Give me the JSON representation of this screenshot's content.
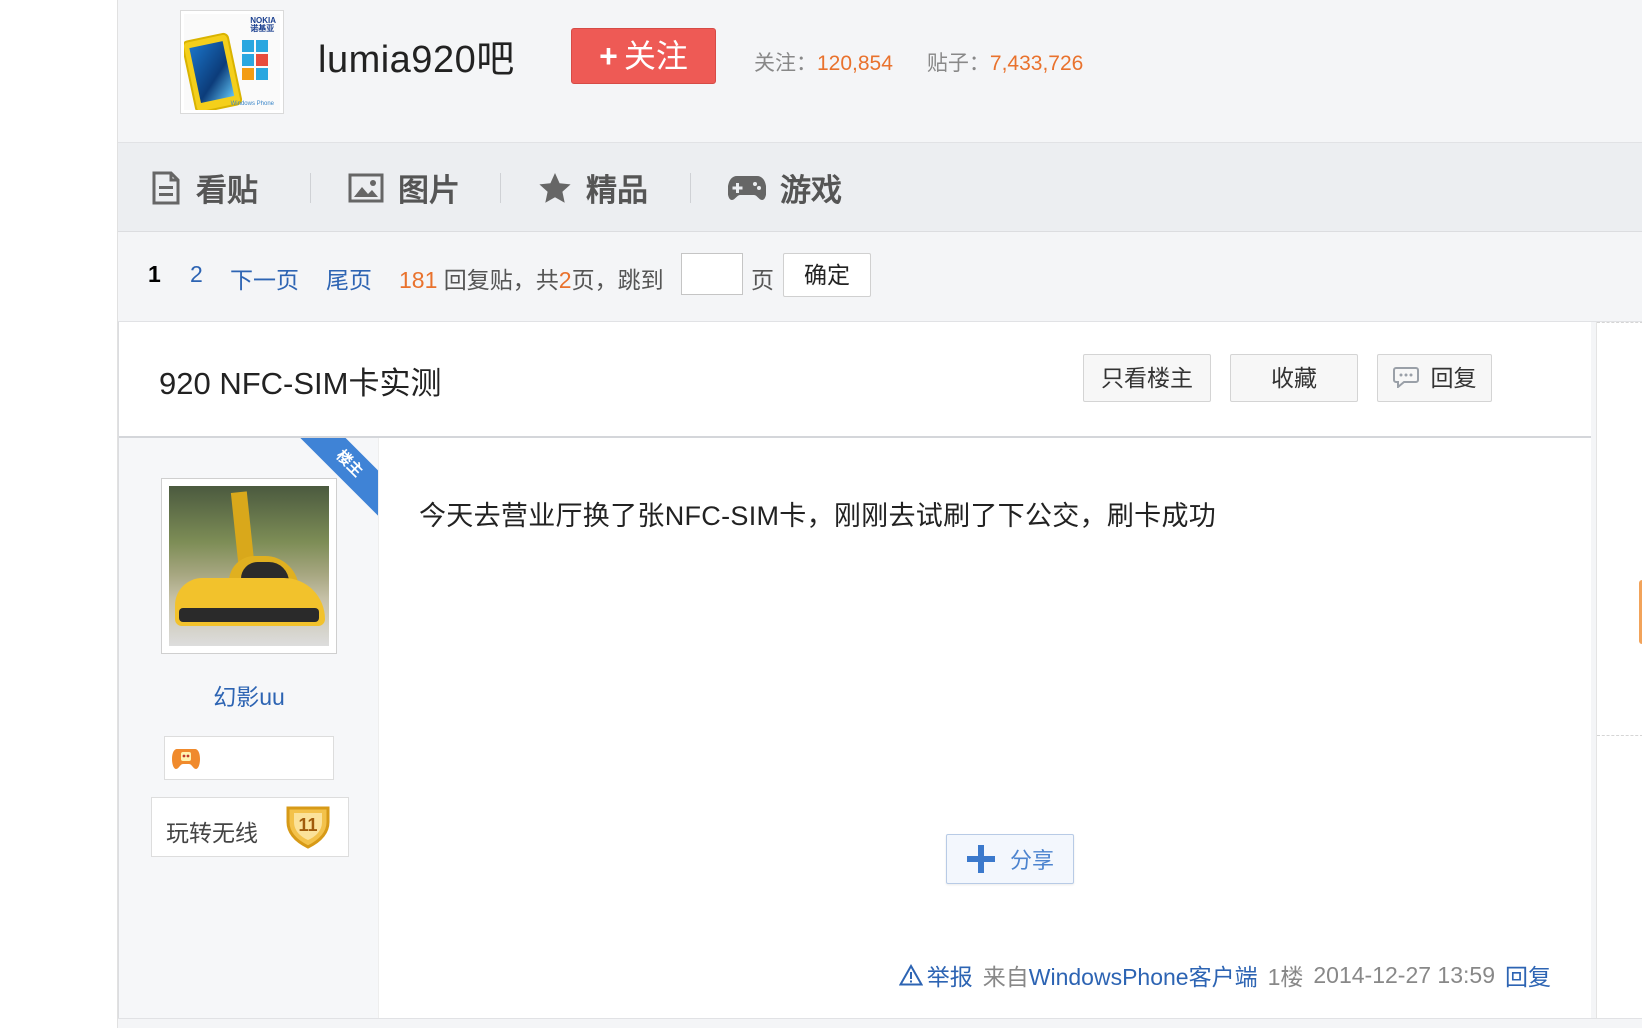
{
  "forum": {
    "name": "lumia920吧",
    "follow_label": "关注",
    "follow_plus": "+",
    "stats_follow_label": "关注：",
    "stats_follow_value": "120,854",
    "stats_posts_label": "贴子：",
    "stats_posts_value": "7,433,726",
    "logo": {
      "brand": "NOKIA\n诺基亚",
      "footer": "Windows Phone"
    }
  },
  "nav": {
    "tabs": [
      {
        "label": "看贴",
        "icon": "document-icon"
      },
      {
        "label": "图片",
        "icon": "picture-icon"
      },
      {
        "label": "精品",
        "icon": "star-icon"
      },
      {
        "label": "游戏",
        "icon": "gamepad-icon"
      }
    ]
  },
  "pager": {
    "current": "1",
    "page2": "2",
    "next": "下一页",
    "last": "尾页",
    "reply_count": "181",
    "reply_text": "回复贴，共",
    "total_pages": "2",
    "pages_suffix": "页，跳到",
    "page_unit": "页",
    "confirm": "确定",
    "jump_value": ""
  },
  "thread": {
    "title": "920 NFC-SIM卡实测",
    "only_op": "只看楼主",
    "favorite": "收藏",
    "reply": "回复"
  },
  "post": {
    "op_ribbon": "楼主",
    "username": "幻影uu",
    "level_name": "玩转无线",
    "level": "11",
    "text": "今天去营业厅换了张NFC-SIM卡，刚刚去试刷了下公交，刷卡成功",
    "share": "分享",
    "report": "举报",
    "from": "来自",
    "client": "WindowsPhone客户端",
    "floor": "1楼",
    "time": "2014-12-27 13:59",
    "reply": "回复"
  },
  "colors": {
    "accent_blue": "#2d64b3",
    "follow_red": "#ee5a55",
    "number_orange": "#e9722d",
    "op_ribbon_blue": "#3f83d6"
  }
}
